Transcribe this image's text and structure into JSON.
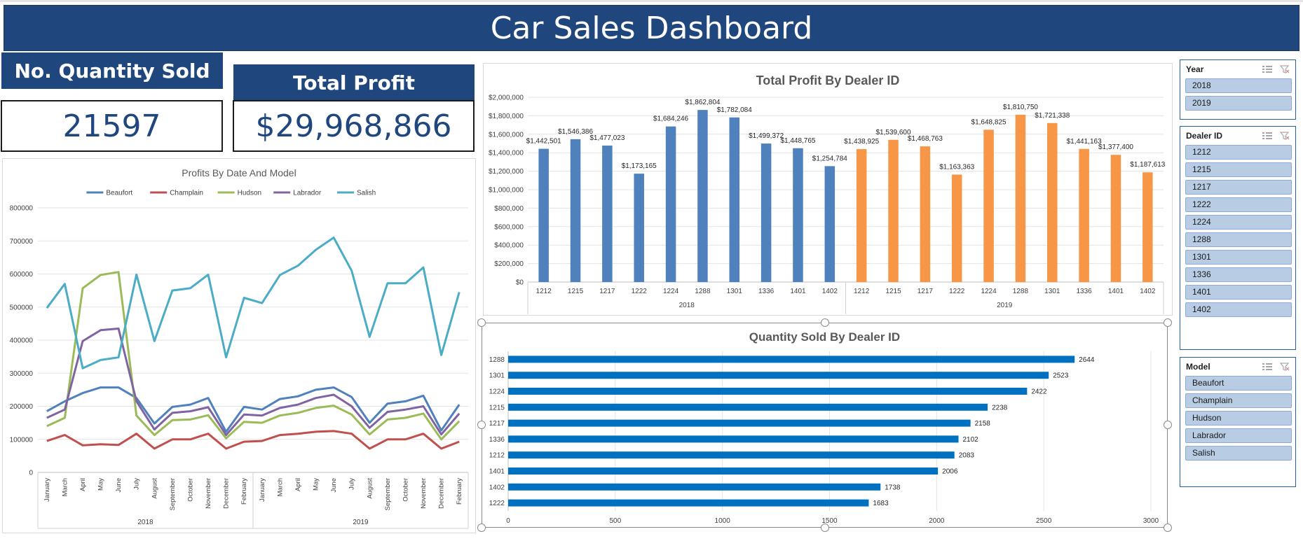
{
  "dashboard": {
    "title": "Car Sales Dashboard"
  },
  "kpis": {
    "quantity": {
      "label": "No. Quantity Sold",
      "value": "21597"
    },
    "profit": {
      "label": "Total Profit",
      "value": "$29,968,866"
    }
  },
  "colors": {
    "brand_navy": "#1f477e",
    "bar_2018": "#4f81bd",
    "bar_2019": "#f79646",
    "bar_quantity": "#0070c0",
    "slicer_item": "#b8cce4"
  },
  "slicers": [
    {
      "title": "Year",
      "icon_multi": "multi-select-icon",
      "icon_clear": "clear-filter-icon",
      "items": [
        "2018",
        "2019"
      ]
    },
    {
      "title": "Dealer ID",
      "icon_multi": "multi-select-icon",
      "icon_clear": "clear-filter-icon",
      "items": [
        "1212",
        "1215",
        "1217",
        "1222",
        "1224",
        "1288",
        "1301",
        "1336",
        "1401",
        "1402"
      ]
    },
    {
      "title": "Model",
      "icon_multi": "multi-select-icon",
      "icon_clear": "clear-filter-icon",
      "items": [
        "Beaufort",
        "Champlain",
        "Hudson",
        "Labrador",
        "Salish"
      ]
    }
  ],
  "chart_data": [
    {
      "id": "profit_by_dealer",
      "type": "bar",
      "title": "Total Profit By Dealer ID",
      "groups": [
        "2018",
        "2019"
      ],
      "categories": [
        "1212",
        "1215",
        "1217",
        "1222",
        "1224",
        "1288",
        "1301",
        "1336",
        "1401",
        "1402"
      ],
      "series": [
        {
          "name": "2018",
          "values": [
            1442501,
            1546386,
            1477023,
            1173165,
            1684246,
            1862804,
            1782084,
            1499372,
            1448765,
            1254784
          ],
          "labels": [
            "$1,442,501",
            "$1,546,386",
            "$1,477,023",
            "$1,173,165",
            "$1,684,246",
            "$1,862,804",
            "$1,782,084",
            "$1,499,372",
            "$1,448,765",
            "$1,254,784"
          ]
        },
        {
          "name": "2019",
          "values": [
            1438925,
            1539600,
            1468763,
            1163363,
            1648825,
            1810750,
            1721338,
            1441163,
            1377400,
            1187613
          ],
          "labels": [
            "$1,438,925",
            "$1,539,600",
            "$1,468,763",
            "$1,163,363",
            "$1,648,825",
            "$1,810,750",
            "$1,721,338",
            "$1,441,163",
            "$1,377,400",
            "$1,187,613"
          ]
        }
      ],
      "ylim": [
        0,
        2000000
      ],
      "yticks": [
        "$0",
        "$200,000",
        "$400,000",
        "$600,000",
        "$800,000",
        "$1,000,000",
        "$1,200,000",
        "$1,400,000",
        "$1,600,000",
        "$1,800,000",
        "$2,000,000"
      ],
      "grid": true
    },
    {
      "id": "quantity_by_dealer",
      "type": "bar",
      "orientation": "horizontal",
      "title": "Quantity Sold By Dealer ID",
      "categories": [
        "1288",
        "1301",
        "1224",
        "1215",
        "1217",
        "1336",
        "1212",
        "1401",
        "1402",
        "1222"
      ],
      "values": [
        2644,
        2523,
        2422,
        2238,
        2158,
        2102,
        2083,
        2006,
        1738,
        1683
      ],
      "xlim": [
        0,
        3000
      ],
      "xticks": [
        "0",
        "500",
        "1000",
        "1500",
        "2000",
        "2500",
        "3000"
      ],
      "grid": true
    },
    {
      "id": "profit_by_date_model",
      "type": "line",
      "title": "Profits By Date And Model",
      "groups": [
        "2018",
        "2019"
      ],
      "x": [
        "January",
        "March",
        "April",
        "May",
        "June",
        "July",
        "August",
        "September",
        "October",
        "November",
        "December",
        "February",
        "January",
        "March",
        "April",
        "May",
        "June",
        "July",
        "August",
        "September",
        "October",
        "November",
        "December",
        "February"
      ],
      "series": [
        {
          "name": "Beaufort",
          "color": "#4f81bd",
          "values": [
            185000,
            215000,
            240000,
            257000,
            257000,
            225000,
            148000,
            198000,
            205000,
            225000,
            123000,
            198000,
            190000,
            222000,
            230000,
            250000,
            257000,
            228000,
            150000,
            208000,
            215000,
            232000,
            127000,
            205000
          ]
        },
        {
          "name": "Champlain",
          "color": "#c0504d",
          "values": [
            95000,
            113000,
            82000,
            85000,
            83000,
            117000,
            72000,
            100000,
            100000,
            117000,
            72000,
            93000,
            95000,
            113000,
            117000,
            123000,
            125000,
            117000,
            72000,
            100000,
            100000,
            117000,
            72000,
            93000
          ]
        },
        {
          "name": "Hudson",
          "color": "#9bbb59",
          "values": [
            140000,
            165000,
            557000,
            597000,
            606000,
            172000,
            113000,
            158000,
            160000,
            173000,
            103000,
            153000,
            150000,
            172000,
            180000,
            195000,
            202000,
            175000,
            115000,
            160000,
            165000,
            178000,
            100000,
            155000
          ]
        },
        {
          "name": "Labrador",
          "color": "#8064a2",
          "values": [
            165000,
            190000,
            397000,
            430000,
            435000,
            215000,
            130000,
            180000,
            185000,
            197000,
            113000,
            175000,
            172000,
            195000,
            205000,
            225000,
            235000,
            200000,
            135000,
            183000,
            190000,
            200000,
            115000,
            178000
          ]
        },
        {
          "name": "Salish",
          "color": "#4bacc6",
          "values": [
            497000,
            570000,
            315000,
            340000,
            348000,
            598000,
            397000,
            550000,
            557000,
            598000,
            348000,
            528000,
            512000,
            597000,
            625000,
            673000,
            710000,
            610000,
            410000,
            572000,
            572000,
            620000,
            355000,
            545000
          ]
        }
      ],
      "ylim": [
        0,
        800000
      ],
      "yticks": [
        "0",
        "100000",
        "200000",
        "300000",
        "400000",
        "500000",
        "600000",
        "700000",
        "800000"
      ],
      "legend": "top",
      "grid": true
    }
  ]
}
